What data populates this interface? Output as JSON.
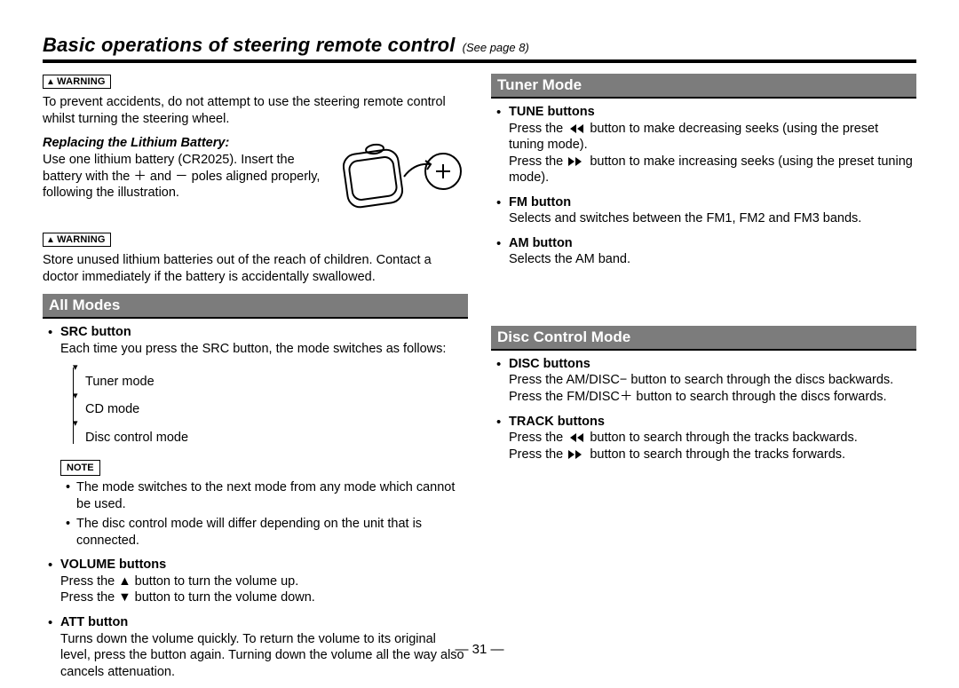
{
  "title_main": "Basic operations of steering remote control",
  "title_see": "(See page 8)",
  "warning_label": "WARNING",
  "note_label": "NOTE",
  "warning1": "To prevent accidents, do not attempt to use the steering remote control whilst turning the steering wheel.",
  "battery_heading": "Replacing the Lithium Battery:",
  "battery_text": "Use one lithium battery (CR2025). Insert the battery with the ＋ and － poles aligned properly, following the illustration.",
  "warning2": "Store unused lithium batteries out of the reach of children. Contact a doctor immediately if the battery is accidentally swallowed.",
  "allmodes": {
    "heading": "All Modes",
    "src_label": "SRC button",
    "src_text": "Each time you press the SRC button, the mode switches as follows:",
    "flow1": "Tuner mode",
    "flow2": "CD mode",
    "flow3": "Disc control mode",
    "note1": "The mode switches to the next mode from any mode which cannot be used.",
    "note2": "The disc control mode will differ depending on the unit that is connected.",
    "vol_label": "VOLUME buttons",
    "vol_line1": "Press the ▲ button to turn the volume up.",
    "vol_line2": "Press the ▼ button to turn the volume down.",
    "att_label": "ATT button",
    "att_text": "Turns down the volume quickly. To return the volume to its original level, press the button again. Turning down the volume all the way also cancels attenuation."
  },
  "tuner": {
    "heading": "Tuner Mode",
    "tune_label": "TUNE buttons",
    "tune_pre": "Press the ",
    "tune_mid": " button to make decreasing seeks (using the preset tuning mode).",
    "tune_pre2": "Press the ",
    "tune_mid2": " button to make increasing seeks (using the preset tuning mode).",
    "fm_label": "FM button",
    "fm_text": "Selects and switches between the FM1, FM2 and FM3 bands.",
    "am_label": "AM button",
    "am_text": "Selects the AM band."
  },
  "disc": {
    "heading": "Disc Control Mode",
    "disc_label": "DISC buttons",
    "disc1": "Press the AM/DISC− button to search through the discs backwards.",
    "disc2": "Press the FM/DISC＋ button to search through the discs forwards.",
    "track_label": "TRACK buttons",
    "track_pre1": "Press the ",
    "track_post1": " button to search through the tracks backwards.",
    "track_pre2": "Press the ",
    "track_post2": " button to search through the tracks forwards."
  },
  "page_number": "— 31 —"
}
